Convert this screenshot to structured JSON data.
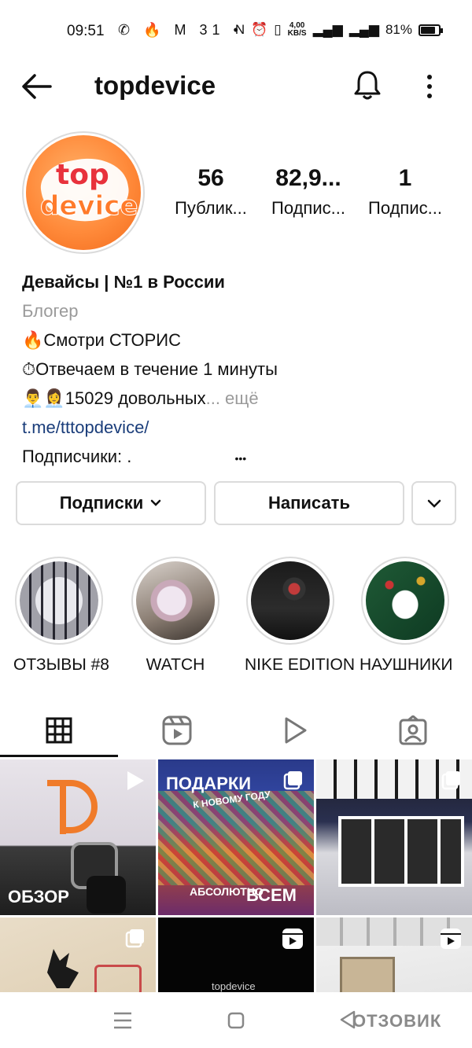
{
  "status_bar": {
    "time": "09:51",
    "left_icons": "✆ 🔥 M 31 •",
    "net_speed": "4,00",
    "net_unit": "KB/S",
    "battery": "81%",
    "battery_level": 0.81
  },
  "header": {
    "title": "topdevice"
  },
  "profile": {
    "avatar_text_top": "top",
    "avatar_text_bottom": "device",
    "stats": [
      {
        "num": "56",
        "label": "Публик..."
      },
      {
        "num": "82,9...",
        "label": "Подпис..."
      },
      {
        "num": "1",
        "label": "Подпис..."
      }
    ],
    "name": "Девайсы | №1 в России",
    "category": "Блогер",
    "bio_lines": [
      "🔥Смотри СТОРИС",
      "⏱Отвечаем в течение 1 минуты",
      "👨‍💼👩‍💼15029 довольных"
    ],
    "more": "... ещё",
    "link": "t.me/tttopdevice/",
    "followers_line": "Подписчики: ."
  },
  "buttons": {
    "following": "Подписки",
    "message": "Написать"
  },
  "highlights": [
    {
      "label": "ОТЗЫВЫ #8"
    },
    {
      "label": "WATCH"
    },
    {
      "label": "NIKE EDITION"
    },
    {
      "label": "НАУШНИКИ"
    }
  ],
  "tabs": [
    "grid-icon",
    "reels-icon",
    "video-icon",
    "tagged-icon"
  ],
  "posts": [
    {
      "caption": "ОБЗОР",
      "badge": "video"
    },
    {
      "caption_top": "ПОДАРКИ",
      "caption_sub": "К НОВОМУ ГОДУ",
      "caption_b1": "АБСОЛЮТНО",
      "caption_b2": "ВСЕМ",
      "badge": "carousel"
    },
    {
      "badge": "carousel"
    },
    {
      "badge": "carousel"
    },
    {
      "caption": "topdevice",
      "badge": "reels"
    },
    {
      "badge": "reels"
    }
  ],
  "watermark": "ОТЗОВИК"
}
